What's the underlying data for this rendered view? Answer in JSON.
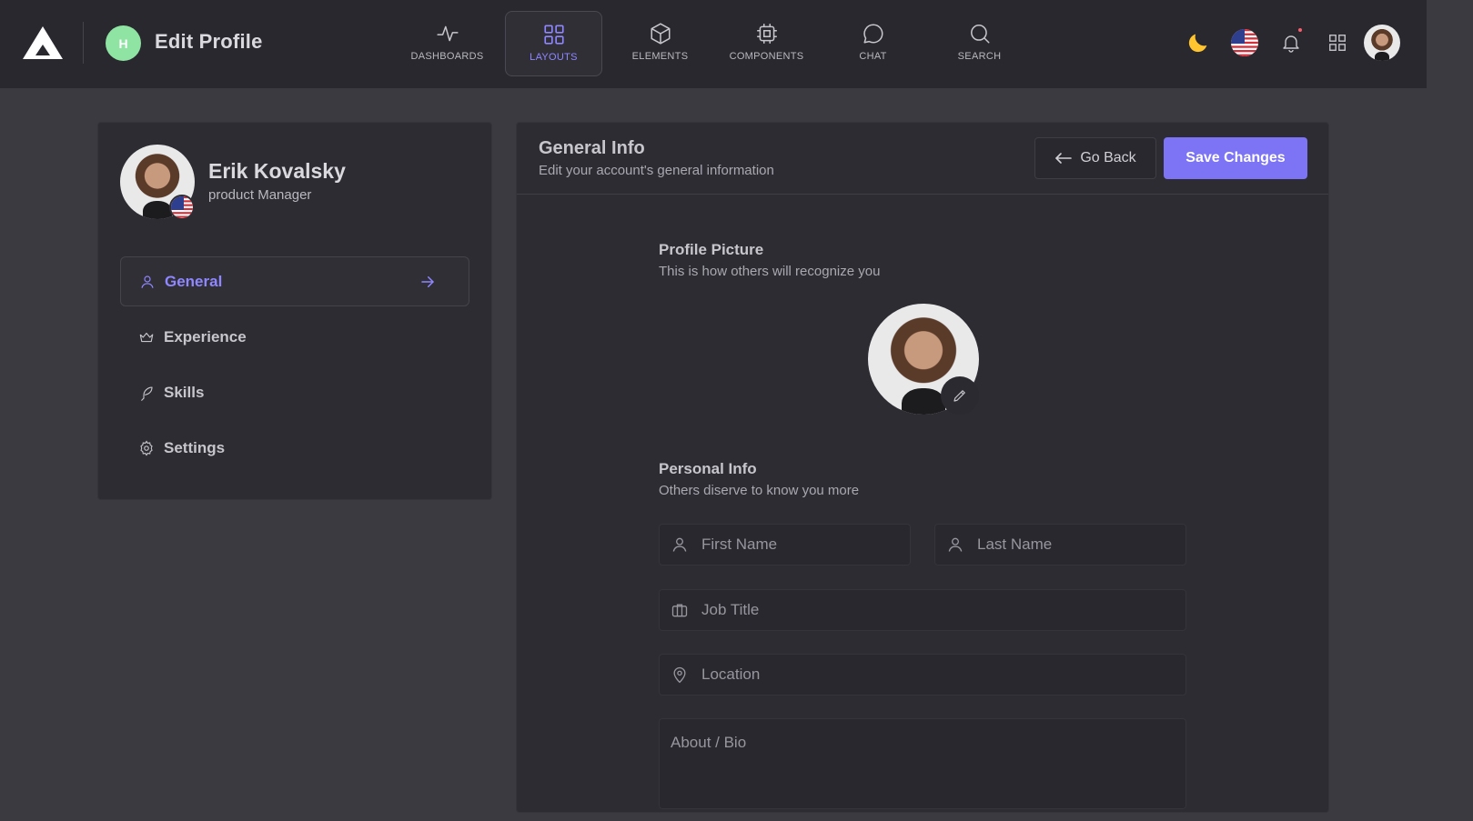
{
  "header": {
    "workspace_initial": "H",
    "title": "Edit Profile",
    "nav": [
      {
        "label": "DASHBOARDS",
        "icon": "activity-icon"
      },
      {
        "label": "LAYOUTS",
        "icon": "grid-icon",
        "active": true
      },
      {
        "label": "ELEMENTS",
        "icon": "box-icon"
      },
      {
        "label": "COMPONENTS",
        "icon": "cpu-icon"
      },
      {
        "label": "CHAT",
        "icon": "chat-icon"
      },
      {
        "label": "SEARCH",
        "icon": "search-icon"
      }
    ],
    "right_icons": [
      "moon-icon",
      "us-flag-icon",
      "bell-icon",
      "apps-grid-icon",
      "user-avatar"
    ]
  },
  "profile": {
    "name": "Erik Kovalsky",
    "role": "product Manager"
  },
  "menu": [
    {
      "label": "General",
      "icon": "user-icon",
      "active": true
    },
    {
      "label": "Experience",
      "icon": "crown-icon"
    },
    {
      "label": "Skills",
      "icon": "feather-icon"
    },
    {
      "label": "Settings",
      "icon": "gear-icon"
    }
  ],
  "general": {
    "title": "General Info",
    "subtitle": "Edit your account's general information",
    "back_label": "Go Back",
    "save_label": "Save Changes",
    "picture_title": "Profile Picture",
    "picture_sub": "This is how others will recognize you",
    "personal_title": "Personal Info",
    "personal_sub": "Others diserve to know you more",
    "fields": {
      "first_name": "First Name",
      "last_name": "Last Name",
      "job_title": "Job Title",
      "location": "Location",
      "bio": "About / Bio"
    }
  },
  "colors": {
    "accent": "#7c73f5",
    "accent_text": "#8e87ff",
    "badge": "#8fe3a3",
    "moon": "#ffc531"
  }
}
